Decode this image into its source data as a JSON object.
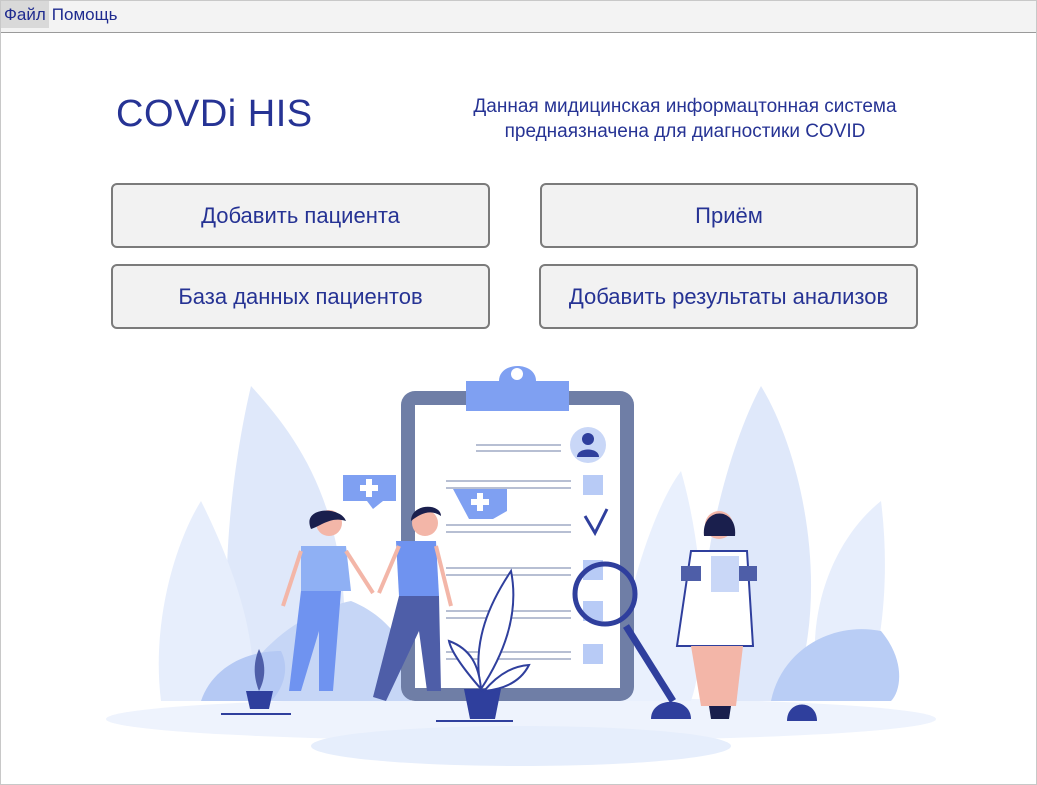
{
  "menu": {
    "items": [
      {
        "label": "Файл"
      },
      {
        "label": "Помощь"
      }
    ]
  },
  "header": {
    "title": "COVDi HIS",
    "description": "Данная мидицинская информацтонная система преднаязначена для диагностики COVID"
  },
  "actions": {
    "add_patient": "Добавить пациента",
    "reception": "Приём",
    "patient_db": "База данных пациентов",
    "add_results": "Добавить результаты анализов"
  },
  "colors": {
    "accent": "#263394",
    "illustration_primary": "#6f93f0",
    "illustration_light": "#dde8fb",
    "illustration_dark": "#2f3f9d"
  }
}
